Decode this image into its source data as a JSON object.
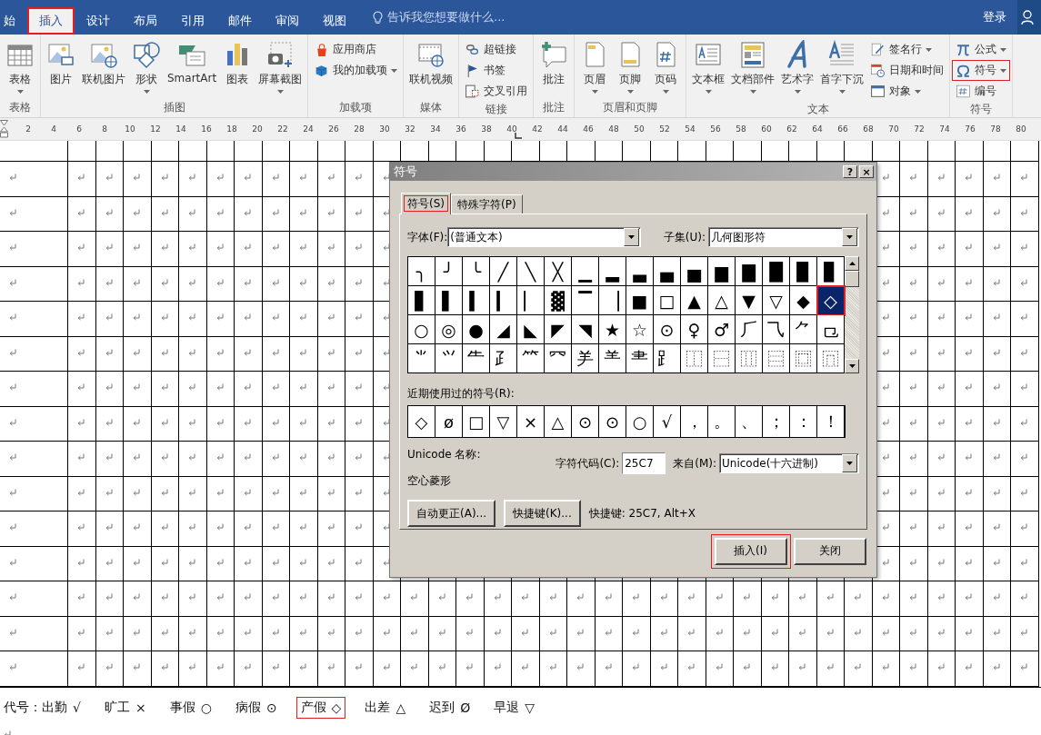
{
  "tabs": [
    {
      "label": "始",
      "selected": false,
      "highlighted": false
    },
    {
      "label": "插入",
      "selected": true,
      "highlighted": true
    },
    {
      "label": "设计",
      "selected": false,
      "highlighted": false
    },
    {
      "label": "布局",
      "selected": false,
      "highlighted": false
    },
    {
      "label": "引用",
      "selected": false,
      "highlighted": false
    },
    {
      "label": "邮件",
      "selected": false,
      "highlighted": false
    },
    {
      "label": "审阅",
      "selected": false,
      "highlighted": false
    },
    {
      "label": "视图",
      "selected": false,
      "highlighted": false
    }
  ],
  "tell_me": {
    "placeholder": "告诉我您想要做什么..."
  },
  "account": {
    "sign_in": "登录"
  },
  "ribbon": {
    "groups": [
      {
        "label": "表格",
        "items": [
          {
            "kind": "large",
            "label": "表格",
            "dropdown": true,
            "highlighted": false
          }
        ]
      },
      {
        "label": "插图",
        "items": [
          {
            "kind": "large",
            "label": "图片",
            "dropdown": false,
            "highlighted": false
          },
          {
            "kind": "large",
            "label": "联机图片",
            "dropdown": false,
            "highlighted": false
          },
          {
            "kind": "large",
            "label": "形状",
            "dropdown": true,
            "highlighted": false
          },
          {
            "kind": "large",
            "label": "SmartArt",
            "dropdown": false,
            "highlighted": false
          },
          {
            "kind": "large",
            "label": "图表",
            "dropdown": false,
            "highlighted": false
          },
          {
            "kind": "large",
            "label": "屏幕截图",
            "dropdown": true,
            "highlighted": false
          }
        ]
      },
      {
        "label": "加载项",
        "items": [
          {
            "kind": "small",
            "label": "应用商店",
            "dropdown": false,
            "highlighted": false
          },
          {
            "kind": "small",
            "label": "我的加载项",
            "dropdown": true,
            "highlighted": false
          }
        ]
      },
      {
        "label": "媒体",
        "items": [
          {
            "kind": "large",
            "label": "联机视频",
            "dropdown": false,
            "highlighted": false
          }
        ]
      },
      {
        "label": "链接",
        "items": [
          {
            "kind": "small",
            "label": "超链接",
            "dropdown": false,
            "highlighted": false
          },
          {
            "kind": "small",
            "label": "书签",
            "dropdown": false,
            "highlighted": false
          },
          {
            "kind": "small",
            "label": "交叉引用",
            "dropdown": false,
            "highlighted": false
          }
        ]
      },
      {
        "label": "批注",
        "items": [
          {
            "kind": "large",
            "label": "批注",
            "dropdown": false,
            "highlighted": false
          }
        ]
      },
      {
        "label": "页眉和页脚",
        "items": [
          {
            "kind": "large",
            "label": "页眉",
            "dropdown": true,
            "highlighted": false
          },
          {
            "kind": "large",
            "label": "页脚",
            "dropdown": true,
            "highlighted": false
          },
          {
            "kind": "large",
            "label": "页码",
            "dropdown": true,
            "highlighted": false
          }
        ]
      },
      {
        "label": "文本",
        "items": [
          {
            "kind": "large",
            "label": "文本框",
            "dropdown": true,
            "highlighted": false
          },
          {
            "kind": "large",
            "label": "文档部件",
            "dropdown": true,
            "highlighted": false
          },
          {
            "kind": "large",
            "label": "艺术字",
            "dropdown": true,
            "highlighted": false
          },
          {
            "kind": "large",
            "label": "首字下沉",
            "dropdown": true,
            "highlighted": false
          },
          {
            "kind": "small",
            "label": "签名行",
            "dropdown": true,
            "highlighted": false
          },
          {
            "kind": "small",
            "label": "日期和时间",
            "dropdown": false,
            "highlighted": false
          },
          {
            "kind": "small",
            "label": "对象",
            "dropdown": true,
            "highlighted": false
          }
        ]
      },
      {
        "label": "符号",
        "items": [
          {
            "kind": "small",
            "label": "公式",
            "dropdown": true,
            "highlighted": false
          },
          {
            "kind": "small",
            "label": "符号",
            "dropdown": true,
            "highlighted": true
          },
          {
            "kind": "small",
            "label": "编号",
            "dropdown": false,
            "highlighted": false
          }
        ]
      }
    ]
  },
  "ruler": {
    "labels": [
      "2",
      "4",
      "6",
      "8",
      "10",
      "12",
      "14",
      "16",
      "18",
      "20",
      "22",
      "24",
      "26",
      "28",
      "30",
      "32",
      "34",
      "36",
      "38",
      "40",
      "42",
      "44",
      "46",
      "48",
      "50",
      "52",
      "54",
      "56",
      "58",
      "60",
      "62",
      "64",
      "66",
      "68",
      "70",
      "72",
      "74",
      "76",
      "78",
      "80"
    ]
  },
  "dialog": {
    "title": "符号",
    "help_button": "?",
    "close_button": "×",
    "tabs": [
      {
        "label": "符号(S)",
        "selected": true,
        "highlighted": true
      },
      {
        "label": "特殊字符(P)",
        "selected": false,
        "highlighted": false
      }
    ],
    "font": {
      "label": "字体(F):",
      "value": "(普通文本)"
    },
    "subset": {
      "label": "子集(U):",
      "value": "几何图形符"
    },
    "symbols": [
      {
        "char": "╮",
        "selected": false
      },
      {
        "char": "╯",
        "selected": false
      },
      {
        "char": "╰",
        "selected": false
      },
      {
        "char": "╱",
        "selected": false
      },
      {
        "char": "╲",
        "selected": false
      },
      {
        "char": "╳",
        "selected": false
      },
      {
        "char": "▁",
        "selected": false
      },
      {
        "char": "▂",
        "selected": false
      },
      {
        "char": "▃",
        "selected": false
      },
      {
        "char": "▄",
        "selected": false
      },
      {
        "char": "▅",
        "selected": false
      },
      {
        "char": "▆",
        "selected": false
      },
      {
        "char": "▇",
        "selected": false
      },
      {
        "char": "█",
        "selected": false
      },
      {
        "char": "▉",
        "selected": false
      },
      {
        "char": "▊",
        "selected": false
      },
      {
        "char": "▋",
        "selected": false
      },
      {
        "char": "▌",
        "selected": false
      },
      {
        "char": "▍",
        "selected": false
      },
      {
        "char": "▎",
        "selected": false
      },
      {
        "char": "▏",
        "selected": false
      },
      {
        "char": "▓",
        "selected": false
      },
      {
        "char": "▔",
        "selected": false
      },
      {
        "char": "▕",
        "selected": false
      },
      {
        "char": "■",
        "selected": false
      },
      {
        "char": "□",
        "selected": false
      },
      {
        "char": "▲",
        "selected": false
      },
      {
        "char": "△",
        "selected": false
      },
      {
        "char": "▼",
        "selected": false
      },
      {
        "char": "▽",
        "selected": false
      },
      {
        "char": "◆",
        "selected": false
      },
      {
        "char": "◇",
        "selected": true
      },
      {
        "char": "○",
        "selected": false
      },
      {
        "char": "◎",
        "selected": false
      },
      {
        "char": "●",
        "selected": false
      },
      {
        "char": "◢",
        "selected": false
      },
      {
        "char": "◣",
        "selected": false
      },
      {
        "char": "◤",
        "selected": false
      },
      {
        "char": "◥",
        "selected": false
      },
      {
        "char": "★",
        "selected": false
      },
      {
        "char": "☆",
        "selected": false
      },
      {
        "char": "⊙",
        "selected": false
      },
      {
        "char": "♀",
        "selected": false
      },
      {
        "char": "♂",
        "selected": false
      },
      {
        "char": "⺁",
        "selected": false
      },
      {
        "char": "⺄",
        "selected": false
      },
      {
        "char": "⺈",
        "selected": false
      },
      {
        "char": "⺋",
        "selected": false
      },
      {
        "char": "⺌",
        "selected": false
      },
      {
        "char": "⺍",
        "selected": false
      },
      {
        "char": "⺧",
        "selected": false
      },
      {
        "char": "⺪",
        "selected": false
      },
      {
        "char": "⺮",
        "selected": false
      },
      {
        "char": "⺳",
        "selected": false
      },
      {
        "char": "⺶",
        "selected": false
      },
      {
        "char": "⺷",
        "selected": false
      },
      {
        "char": "⺻",
        "selected": false
      },
      {
        "char": "⻊",
        "selected": false
      },
      {
        "char": "⿰",
        "selected": false
      },
      {
        "char": "⿱",
        "selected": false
      },
      {
        "char": "⿲",
        "selected": false
      },
      {
        "char": "⿳",
        "selected": false
      },
      {
        "char": "⿴",
        "selected": false
      },
      {
        "char": "⿵",
        "selected": false
      }
    ],
    "recent": {
      "label": "近期使用过的符号(R):",
      "symbols": [
        "◇",
        "ø",
        "□",
        "▽",
        "×",
        "△",
        "⊙",
        "⊙",
        "○",
        "√",
        "，",
        "。",
        "、",
        "；",
        "：",
        "！"
      ]
    },
    "unicode_name": {
      "label": "Unicode 名称:",
      "value": "空心菱形"
    },
    "char_code": {
      "label": "字符代码(C):",
      "value": "25C7"
    },
    "from": {
      "label": "来自(M):",
      "value": "Unicode(十六进制)"
    },
    "buttons": [
      {
        "label": "自动更正(A)..."
      },
      {
        "label": "快捷键(K)..."
      }
    ],
    "shortcut_text": "快捷键: 25C7, Alt+X",
    "footer_buttons": [
      {
        "label": "插入(I)",
        "highlighted": true
      },
      {
        "label": "关闭",
        "highlighted": false
      }
    ]
  },
  "legend": {
    "prefix": "代号：",
    "items": [
      {
        "label": "出勤",
        "symbol": "√",
        "highlighted": false
      },
      {
        "label": "旷工",
        "symbol": "×",
        "highlighted": false
      },
      {
        "label": "事假",
        "symbol": "○",
        "highlighted": false
      },
      {
        "label": "病假",
        "symbol": "⊙",
        "highlighted": false
      },
      {
        "label": "产假",
        "symbol": "◇",
        "highlighted": true
      },
      {
        "label": "出差",
        "symbol": "△",
        "highlighted": false
      },
      {
        "label": "迟到",
        "symbol": "Ø",
        "highlighted": false
      },
      {
        "label": "早退",
        "symbol": "▽",
        "highlighted": false
      }
    ]
  }
}
